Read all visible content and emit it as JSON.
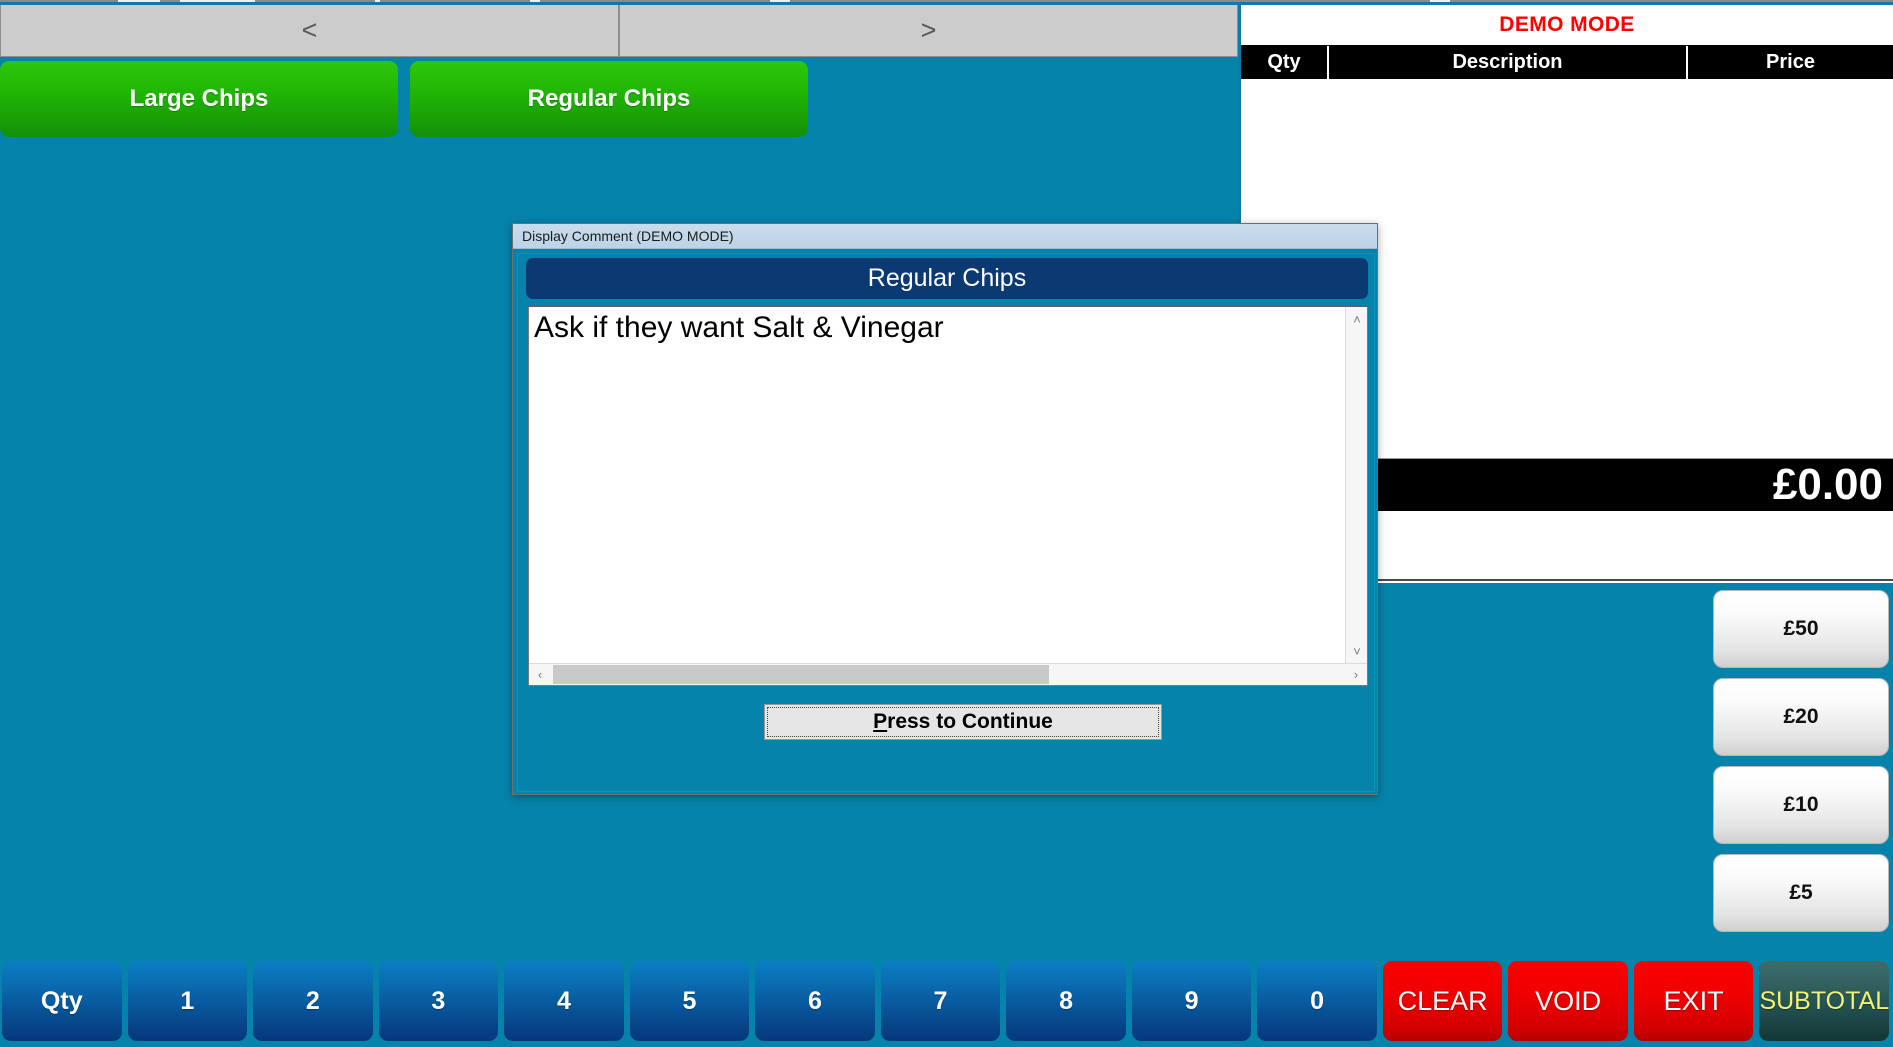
{
  "app": {
    "background_color": "#0683ab"
  },
  "nav": {
    "prev_label": "<",
    "next_label": ">"
  },
  "products": [
    {
      "label": "Large Chips"
    },
    {
      "label": "Regular Chips"
    }
  ],
  "receipt": {
    "demo_banner": "DEMO MODE",
    "columns": {
      "qty": "Qty",
      "description": "Description",
      "price": "Price"
    },
    "rows": [],
    "total": "£0.00"
  },
  "denominations": [
    {
      "label": "£50"
    },
    {
      "label": "£20"
    },
    {
      "label": "£10"
    },
    {
      "label": "£5"
    }
  ],
  "keypad": [
    {
      "label": "Qty",
      "kind": "num"
    },
    {
      "label": "1",
      "kind": "num"
    },
    {
      "label": "2",
      "kind": "num"
    },
    {
      "label": "3",
      "kind": "num"
    },
    {
      "label": "4",
      "kind": "num"
    },
    {
      "label": "5",
      "kind": "num"
    },
    {
      "label": "6",
      "kind": "num"
    },
    {
      "label": "7",
      "kind": "num"
    },
    {
      "label": "8",
      "kind": "num"
    },
    {
      "label": "9",
      "kind": "num"
    },
    {
      "label": "0",
      "kind": "num"
    },
    {
      "label": "CLEAR",
      "kind": "red"
    },
    {
      "label": "VOID",
      "kind": "red"
    },
    {
      "label": "EXIT",
      "kind": "red"
    },
    {
      "label": "SUBTOTAL",
      "kind": "subtotal"
    }
  ],
  "dialog": {
    "title": "Display Comment (DEMO MODE)",
    "banner": "Regular Chips",
    "comment_text": "Ask if they want Salt & Vinegar",
    "continue_accel": "P",
    "continue_rest": "ress to Continue",
    "scroll_up_icon": "˄",
    "scroll_down_icon": "˅",
    "scroll_left_icon": "‹",
    "scroll_right_icon": "›"
  },
  "colors": {
    "teal": "#0683ab",
    "green": "#1ab606",
    "red": "#f00000",
    "navy": "#0b3a72",
    "demo_red": "#ff0000",
    "subtotal_yellow": "#f2f277"
  }
}
